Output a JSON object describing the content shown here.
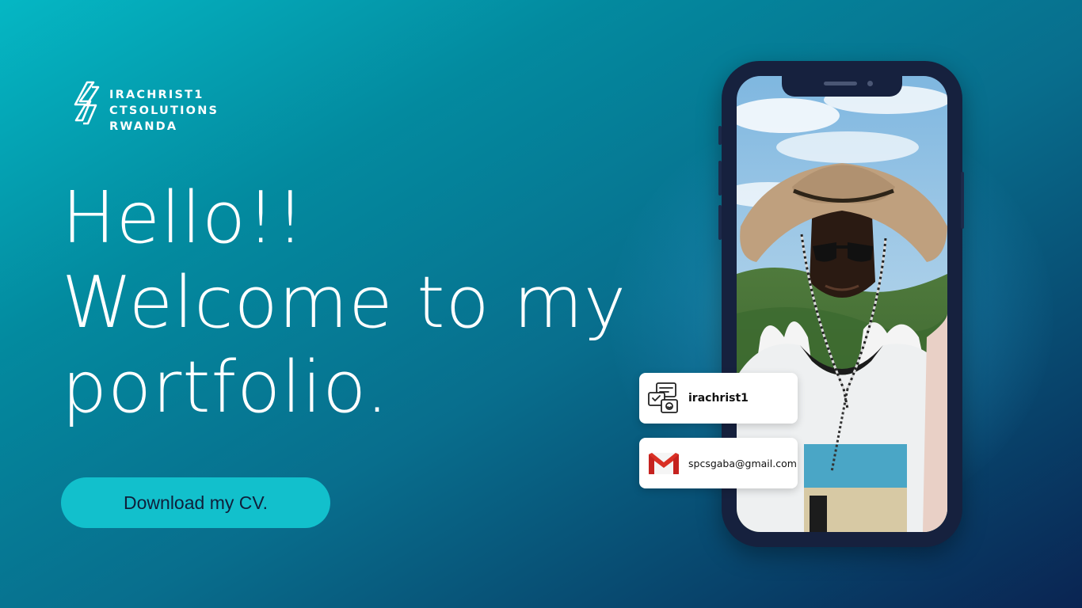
{
  "brand": {
    "logo_icon": "lightning-s-icon",
    "name_lines": [
      "IRACHRIST1",
      "CTSOLUTIONS",
      "RWANDA"
    ]
  },
  "hero": {
    "headline_lines": [
      "Hello!!",
      "Welcome to my",
      "portfolio."
    ],
    "cta_label": "Download my CV."
  },
  "contacts": {
    "social": {
      "icon": "social-media-icon",
      "handle": "irachrist1"
    },
    "email": {
      "icon": "gmail-icon",
      "address": "spcsgaba@gmail.com"
    }
  },
  "phone": {
    "photo": "portrait-photo"
  },
  "colors": {
    "accent": "#12c0cc",
    "background_top": "#05b7c4",
    "background_bottom": "#0a2452",
    "phone_frame": "#16213e",
    "button_text": "#0f1f3a"
  }
}
